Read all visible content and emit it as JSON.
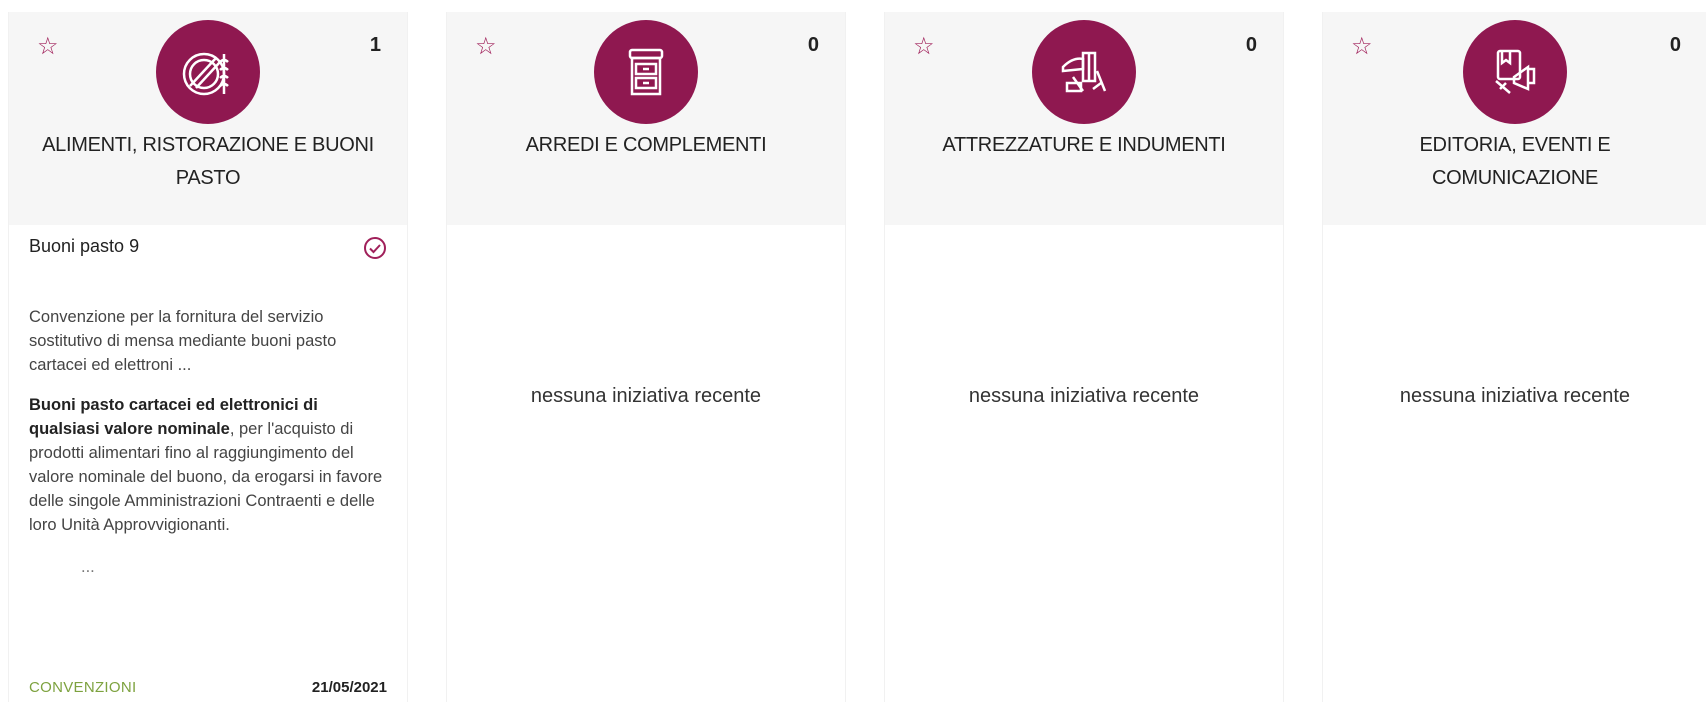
{
  "colors": {
    "accent": "#8f1850",
    "star": "#a0205a",
    "type_green": "#7da23f"
  },
  "cards": [
    {
      "title": "ALIMENTI, RISTORAZIONE E BUONI PASTO",
      "count": "1",
      "icon": "food-icon",
      "item": {
        "title": "Buoni pasto 9",
        "description": "Convenzione per la fornitura del servizio sostitutivo di mensa mediante buoni pasto cartacei ed elettroni ...",
        "long_bold": "Buoni pasto cartacei ed elettronici di qualsiasi valore nominale",
        "long_rest": ", per l'acquisto di prodotti alimentari fino al raggiungimento del valore nominale del buono, da erogarsi in favore delle singole Amministrazioni Contraenti e delle loro Unità Approvvigionanti.",
        "ellipsis": "...",
        "type": "CONVENZIONI",
        "date": "21/05/2021"
      }
    },
    {
      "title": "ARREDI E COMPLEMENTI",
      "count": "0",
      "icon": "cabinet-icon",
      "empty_text": "nessuna iniziativa recente"
    },
    {
      "title": "ATTREZZATURE E INDUMENTI",
      "count": "0",
      "icon": "tools-clothing-icon",
      "empty_text": "nessuna iniziativa recente"
    },
    {
      "title": "EDITORIA, EVENTI E COMUNICAZIONE",
      "count": "0",
      "icon": "books-megaphone-icon",
      "empty_text": "nessuna iniziativa recente"
    }
  ]
}
